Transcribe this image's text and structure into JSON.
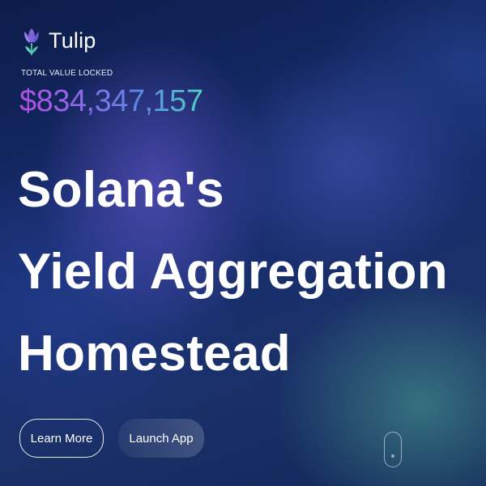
{
  "brand": {
    "name": "Tulip",
    "logo_icon": "tulip-icon",
    "logo_colors": [
      "#7a64d8",
      "#5fd2bd"
    ]
  },
  "tvl": {
    "label": "TOTAL VALUE LOCKED",
    "value": "$834,347,157",
    "gradient": [
      "#b34fe0",
      "#8a6be6",
      "#5b88e8",
      "#4fd1c0"
    ]
  },
  "hero": {
    "lines": [
      "Solana's",
      "Yield Aggregation",
      "Homestead"
    ]
  },
  "buttons": {
    "learn_more": "Learn More",
    "launch_app": "Launch App"
  },
  "scroll_indicator": {
    "icon": "mouse-scroll-icon"
  }
}
